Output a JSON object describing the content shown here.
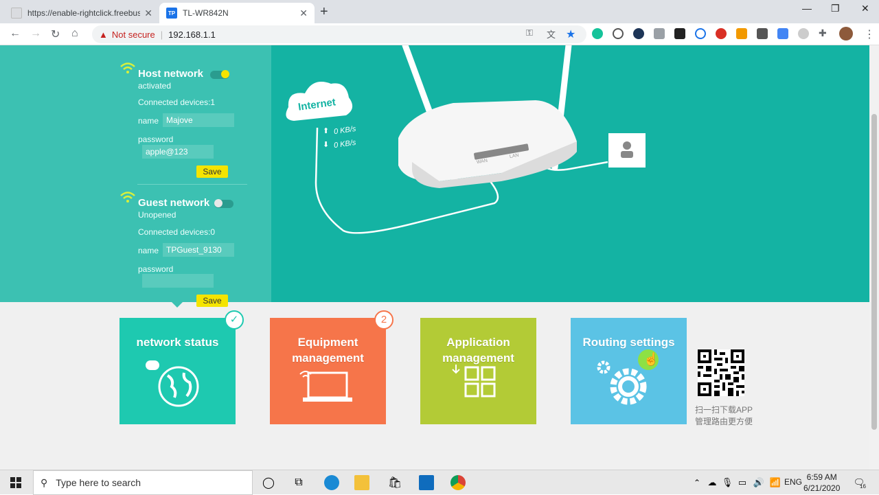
{
  "browser": {
    "tabs": [
      {
        "title": "https://enable-rightclick.freebusi",
        "active": false
      },
      {
        "title": "TL-WR842N",
        "active": true
      }
    ],
    "address": {
      "warning": "Not secure",
      "url": "192.168.1.1"
    }
  },
  "left_panel": {
    "host": {
      "label": "Host network",
      "status": "activated",
      "devices": "Connected devices:1",
      "name_label": "name",
      "name_value": "Majove",
      "password_label": "password",
      "password_value": "apple@123",
      "save_label": "Save"
    },
    "guest": {
      "label": "Guest network",
      "status": "Unopened",
      "devices": "Connected devices:0",
      "name_label": "name",
      "name_value": "TPGuest_9130",
      "password_label": "password",
      "password_value": "",
      "save_label": "Save"
    }
  },
  "hero": {
    "cloud_label": "Internet",
    "upload": "0 KB/s",
    "download": "0 KB/s",
    "router_ports": {
      "wan": "WAN",
      "lan": "LAN"
    }
  },
  "tiles": [
    {
      "line1": "network status",
      "line2": "",
      "color": "#1ec9b0",
      "badge": "check"
    },
    {
      "line1": "Equipment",
      "line2": "management",
      "color": "#f6754a",
      "badge": "2"
    },
    {
      "line1": "Application",
      "line2": "management",
      "color": "#b3cb36",
      "badge": ""
    },
    {
      "line1": "Routing settings",
      "line2": "",
      "color": "#5bc3e5",
      "badge": ""
    }
  ],
  "qr": {
    "line1": "扫一扫下载APP",
    "line2": "管理路由更方便"
  },
  "taskbar": {
    "search_placeholder": "Type here to search",
    "lang": "ENG",
    "time": "6:59 AM",
    "date": "6/21/2020",
    "notif_count": "16"
  }
}
